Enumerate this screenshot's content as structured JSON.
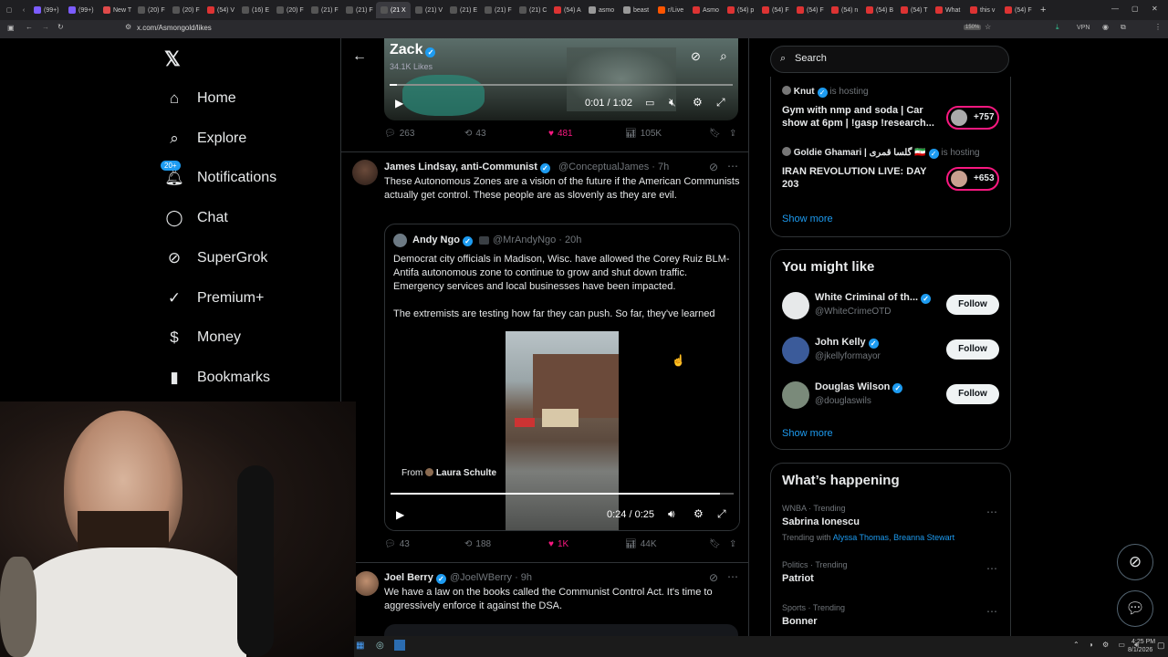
{
  "browser": {
    "tabs": [
      {
        "label": "(99+)",
        "color": "#7c5cff"
      },
      {
        "label": "(99+)",
        "color": "#7c5cff"
      },
      {
        "label": "New T",
        "color": "#e04a4a"
      },
      {
        "label": "(20) F",
        "color": "#555"
      },
      {
        "label": "(20) F",
        "color": "#555"
      },
      {
        "label": "(54) V",
        "color": "#d33"
      },
      {
        "label": "(16) E",
        "color": "#555"
      },
      {
        "label": "(20) F",
        "color": "#555"
      },
      {
        "label": "(21) F",
        "color": "#555"
      },
      {
        "label": "(21) F",
        "color": "#555"
      },
      {
        "label": "(21 X",
        "color": "#555"
      },
      {
        "label": "(21) V",
        "color": "#555"
      },
      {
        "label": "(21) E",
        "color": "#555"
      },
      {
        "label": "(21) F",
        "color": "#555"
      },
      {
        "label": "(21) C",
        "color": "#555"
      },
      {
        "label": "(54) A",
        "color": "#d33"
      },
      {
        "label": "asmo",
        "color": "#999"
      },
      {
        "label": "beast",
        "color": "#999"
      },
      {
        "label": "r/Live",
        "color": "#ff5500"
      },
      {
        "label": "Asmo",
        "color": "#d33"
      },
      {
        "label": "(54) p",
        "color": "#d33"
      },
      {
        "label": "(54) F",
        "color": "#d33"
      },
      {
        "label": "(54) F",
        "color": "#d33"
      },
      {
        "label": "(54) n",
        "color": "#d33"
      },
      {
        "label": "(54) B",
        "color": "#d33"
      },
      {
        "label": "(54) T",
        "color": "#d33"
      },
      {
        "label": "What",
        "color": "#d33"
      },
      {
        "label": "this v",
        "color": "#d33"
      },
      {
        "label": "(54) F",
        "color": "#d33"
      }
    ],
    "url": "x.com/Asmongold/likes",
    "zoom": "150%",
    "vpn_label": "VPN"
  },
  "sidebar": {
    "items": [
      {
        "label": "Home",
        "icon": "⌂"
      },
      {
        "label": "Explore",
        "icon": "⌕"
      },
      {
        "label": "Notifications",
        "icon": "🔔︎",
        "badge": "20+"
      },
      {
        "label": "Chat",
        "icon": "◯"
      },
      {
        "label": "SuperGrok",
        "icon": "⊘"
      },
      {
        "label": "Premium+",
        "icon": "✓"
      },
      {
        "label": "Money",
        "icon": "$"
      },
      {
        "label": "Bookmarks",
        "icon": "▮"
      }
    ]
  },
  "header": {
    "title": "Zack",
    "subtitle": "34.1K Likes"
  },
  "top_video": {
    "time": "0:01 / 1:02"
  },
  "top_actions": {
    "replies": "263",
    "reposts": "43",
    "likes": "481",
    "views": "105K"
  },
  "tweet1": {
    "name": "James Lindsay, anti-Communist",
    "handle": "@ConceptualJames · 7h",
    "text": "These Autonomous Zones are a vision of the future if the American Communists actually get control. These people are as slovenly as they are evil.",
    "quote": {
      "name": "Andy Ngo",
      "handle": "@MrAndyNgo · 20h",
      "text1": "Democrat city officials in Madison, Wisc. have allowed the Corey Ruiz BLM-Antifa autonomous zone to continue to grow and shut down traffic. Emergency services and local businesses have been impacted.",
      "text2": "The extremists are testing how far they can push. So far, they've learned",
      "from_prefix": "From",
      "from_name": "Laura Schulte",
      "time": "0:24 / 0:25"
    },
    "actions": {
      "replies": "43",
      "reposts": "188",
      "likes": "1K",
      "views": "44K"
    }
  },
  "tweet2": {
    "name": "Joel Berry",
    "handle": "@JoelWBerry · 9h",
    "text": "We have a law on the books called the Communist Control Act. It's time to aggressively enforce it against the DSA."
  },
  "right": {
    "search_placeholder": "Search",
    "spaces": [
      {
        "host": "Knut",
        "status": "is hosting",
        "title": "Gym with nmp and soda | Car show at 6pm | !gasp !research...",
        "count": "+757"
      },
      {
        "host": "Goldie Ghamari | گلسا قمری 🇮🇷",
        "status": "is hosting",
        "title": "IRAN REVOLUTION LIVE: DAY 203",
        "count": "+653"
      }
    ],
    "spaces_show_more": "Show more",
    "might_like_title": "You might like",
    "might_like": [
      {
        "name": "White Criminal of th...",
        "handle": "@WhiteCrimeOTD",
        "button": "Follow"
      },
      {
        "name": "John Kelly",
        "handle": "@jkellyformayor",
        "button": "Follow"
      },
      {
        "name": "Douglas Wilson",
        "handle": "@douglaswils",
        "button": "Follow"
      }
    ],
    "might_like_show_more": "Show more",
    "happening_title": "What’s happening",
    "trends": [
      {
        "meta": "WNBA · Trending",
        "name": "Sabrina Ionescu",
        "with_prefix": "Trending with ",
        "with1": "Alyssa Thomas",
        "with2": "Breanna Stewart"
      },
      {
        "meta": "Politics · Trending",
        "name": "Patriot"
      },
      {
        "meta": "Sports · Trending",
        "name": "Bonner"
      }
    ]
  },
  "taskbar": {
    "time": "4:25 PM",
    "date": "8/1/2026"
  },
  "colors": {
    "accent": "#1d9bf0",
    "like": "#f91880",
    "bg": "#000000",
    "border": "#2f3336",
    "muted": "#71767b"
  }
}
